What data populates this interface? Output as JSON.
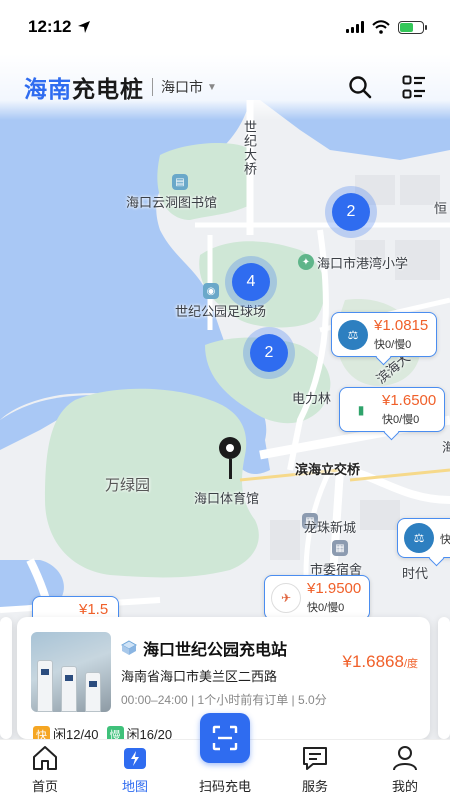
{
  "status_bar": {
    "time": "12:12"
  },
  "header": {
    "brand_highlight": "海南",
    "brand_rest": "充电桩",
    "city": "海口市",
    "search_icon": "search-icon",
    "list_icon": "list-view-icon"
  },
  "map": {
    "labels": {
      "bridge": "世纪大桥",
      "library": "海口云洞图书馆",
      "school": "海口市港湾小学",
      "stadium": "世纪公园足球场",
      "power": "电力林",
      "overpass": "滨海立交桥",
      "park": "万绿园",
      "gym": "海口体育馆",
      "longzhu": "龙珠新城",
      "dorm": "市委宿舍",
      "shidai": "时代",
      "heng": "恒",
      "binhai": "滨海大",
      "hai": "海"
    },
    "clusters": [
      "2",
      "4",
      "2"
    ],
    "price_tags": [
      {
        "price": "¥1.0815",
        "sub": "快0/慢0"
      },
      {
        "price": "¥1.6500",
        "sub": "快0/慢0"
      },
      {
        "price": "¥1.9500",
        "sub": "快0/慢0"
      },
      {
        "price": "¥1.5",
        "sub": ""
      },
      {
        "price": "",
        "sub": "快"
      }
    ]
  },
  "station_card": {
    "name": "海口世纪公园充电站",
    "address": "海南省海口市美兰区二西路",
    "price": "¥1.6868",
    "price_unit": "/度",
    "hours": "00:00–24:00",
    "recent_orders": "1个小时前有订单",
    "rating": "5.0分",
    "fast_badge": "快",
    "fast_value": "闲12/40",
    "slow_badge": "慢",
    "slow_value": "闲16/20"
  },
  "tabs": [
    {
      "label": "首页",
      "icon": "home-icon"
    },
    {
      "label": "地图",
      "icon": "map-icon"
    },
    {
      "label": "扫码充电",
      "icon": "scan-icon"
    },
    {
      "label": "服务",
      "icon": "service-chat-icon"
    },
    {
      "label": "我的",
      "icon": "profile-icon"
    }
  ],
  "colors": {
    "accent": "#2f6cf0",
    "price": "#f0602a",
    "fast_badge": "#f5a623",
    "slow_badge": "#3fc17a",
    "water": "#a9c8f5",
    "park": "#cfe7d6"
  }
}
